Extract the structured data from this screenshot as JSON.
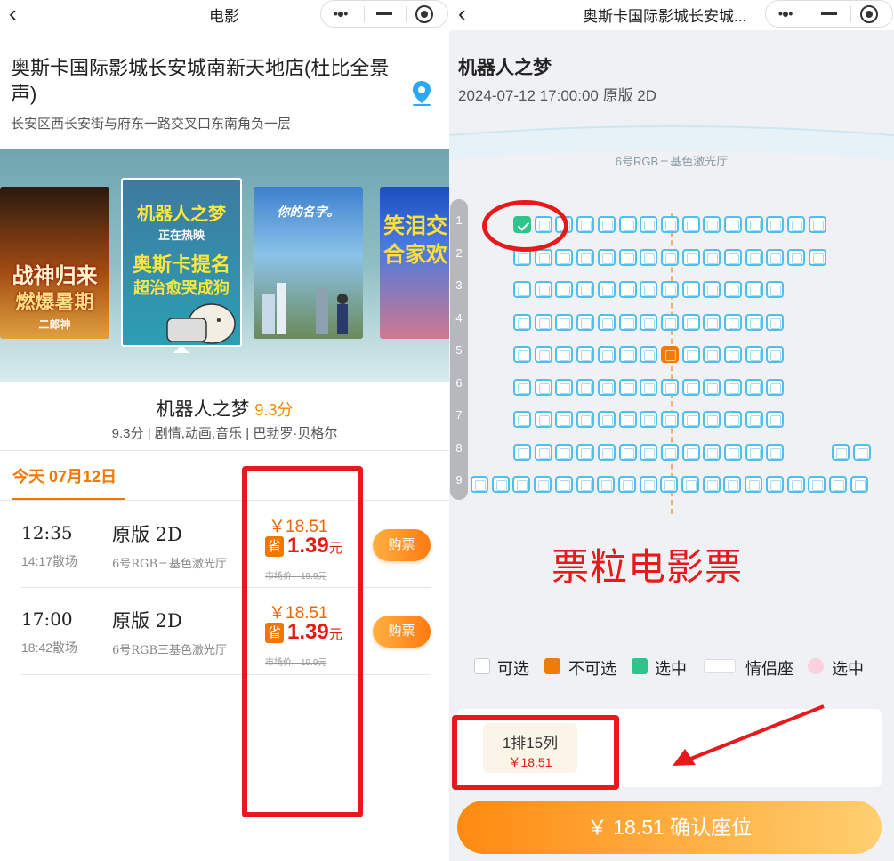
{
  "left": {
    "title": "电影",
    "cinema": {
      "name": "奥斯卡国际影城长安城南新天地店(杜比全景声)",
      "address": "长安区西长安街与府东一路交叉口东南角负一层"
    },
    "posters": [
      {
        "name": "poster-zhanshen",
        "lines": [
          "战神归来",
          "燃爆暑期",
          "二郎神"
        ]
      },
      {
        "name": "poster-robot-dreams",
        "lines": [
          "机器人之梦",
          "正在热映",
          "奥斯卡提名",
          "超治愈哭成狗"
        ]
      },
      {
        "name": "poster-your-name",
        "lines": [
          "你的名字。"
        ]
      },
      {
        "name": "poster-comedy",
        "lines": [
          "笑泪交",
          "合家欢"
        ]
      }
    ],
    "movie": {
      "title": "机器人之梦",
      "score": "9.3分",
      "meta": "9.3分 | 剧情,动画,音乐 | 巴勃罗·贝格尔"
    },
    "date_tab": "今天 07月12日",
    "showtimes": [
      {
        "time": "12:35",
        "end": "14:17散场",
        "type": "原版 2D",
        "hall": "6号RGB三基色激光厅",
        "price": "￥18.51",
        "badge": "省",
        "discount": "1.39",
        "unit": "元",
        "market": "市场价：19.9元",
        "buy": "购票"
      },
      {
        "time": "17:00",
        "end": "18:42散场",
        "type": "原版 2D",
        "hall": "6号RGB三基色激光厅",
        "price": "￥18.51",
        "badge": "省",
        "discount": "1.39",
        "unit": "元",
        "market": "市场价：19.9元",
        "buy": "购票"
      }
    ]
  },
  "right": {
    "title": "奥斯卡国际影城长安城...",
    "movie_title": "机器人之梦",
    "session": "2024-07-12 17:00:00 原版 2D",
    "hall": "6号RGB三基色激光厅",
    "row_numbers": [
      "1",
      "2",
      "3",
      "4",
      "5",
      "6",
      "7",
      "8",
      "9"
    ],
    "seat_rows": [
      {
        "row": 1,
        "count": 15,
        "selected": [
          1
        ],
        "sold": []
      },
      {
        "row": 2,
        "count": 15,
        "selected": [],
        "sold": []
      },
      {
        "row": 3,
        "count": 13,
        "selected": [],
        "sold": []
      },
      {
        "row": 4,
        "count": 13,
        "selected": [],
        "sold": []
      },
      {
        "row": 5,
        "count": 13,
        "selected": [],
        "sold": [
          8
        ]
      },
      {
        "row": 6,
        "count": 13,
        "selected": [],
        "sold": []
      },
      {
        "row": 7,
        "count": 13,
        "selected": [],
        "sold": []
      },
      {
        "row": 8,
        "count": 13,
        "extra_right": 2,
        "selected": [],
        "sold": []
      },
      {
        "row": 9,
        "count": 19,
        "selected": [],
        "sold": []
      }
    ],
    "watermark": "票粒电影票",
    "legend": {
      "available": "可选",
      "unavailable": "不可选",
      "selected": "选中",
      "couple": "情侣座",
      "couple_selected": "选中"
    },
    "selection": {
      "seat": "1排15列",
      "price": "￥18.51"
    },
    "confirm": "￥ 18.51 确认座位"
  },
  "colors": {
    "accent": "#f07800",
    "seat": "#52bfe8",
    "selected": "#2ec48b",
    "sold": "#f07a0a",
    "annotation": "#e8191a"
  }
}
